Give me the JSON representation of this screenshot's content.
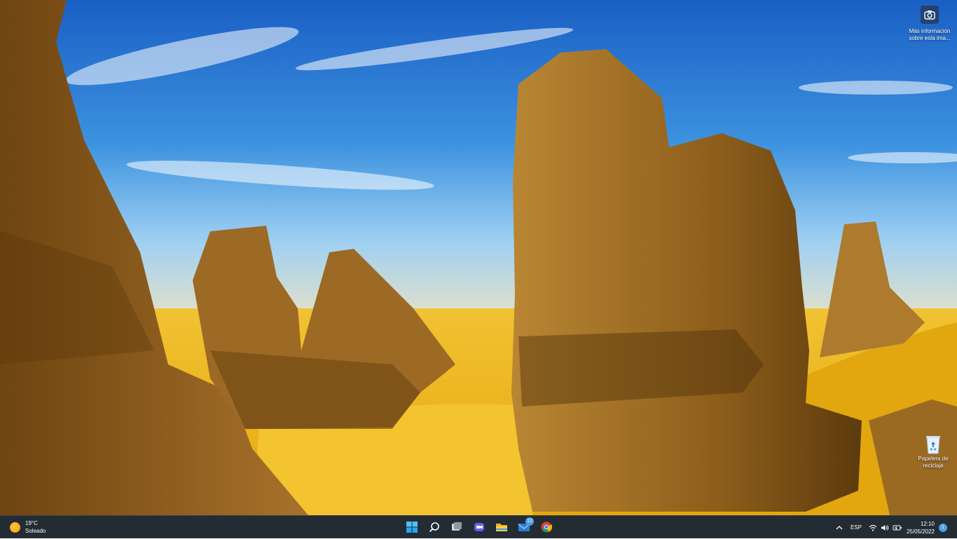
{
  "desktop": {
    "wallpaper_info": {
      "line1": "Más información",
      "line2": "sobre esta ima...",
      "icon": "camera-icon"
    },
    "recycle_bin": {
      "line1": "Papelera de",
      "line2": "reciclaje",
      "icon": "recycle-bin-icon"
    }
  },
  "taskbar": {
    "weather": {
      "temp": "19°C",
      "condition": "Soleado",
      "icon": "sun-icon"
    },
    "apps": [
      {
        "name": "start",
        "icon": "windows-logo-icon"
      },
      {
        "name": "search",
        "icon": "search-icon"
      },
      {
        "name": "task-view",
        "icon": "task-view-icon"
      },
      {
        "name": "chat",
        "icon": "teams-chat-icon"
      },
      {
        "name": "file-explorer",
        "icon": "folder-icon"
      },
      {
        "name": "mail",
        "icon": "mail-icon",
        "badge": "12"
      },
      {
        "name": "chrome",
        "icon": "chrome-icon"
      }
    ],
    "tray": {
      "language": "ESP",
      "time": "12:10",
      "date": "25/05/2022",
      "notifications": "1"
    }
  },
  "colors": {
    "taskbar_bg": "#232c33",
    "accent": "#4aa0e8",
    "sky": "#2f7fd6",
    "sand": "#f2b81c",
    "rock": "#a86e22"
  }
}
